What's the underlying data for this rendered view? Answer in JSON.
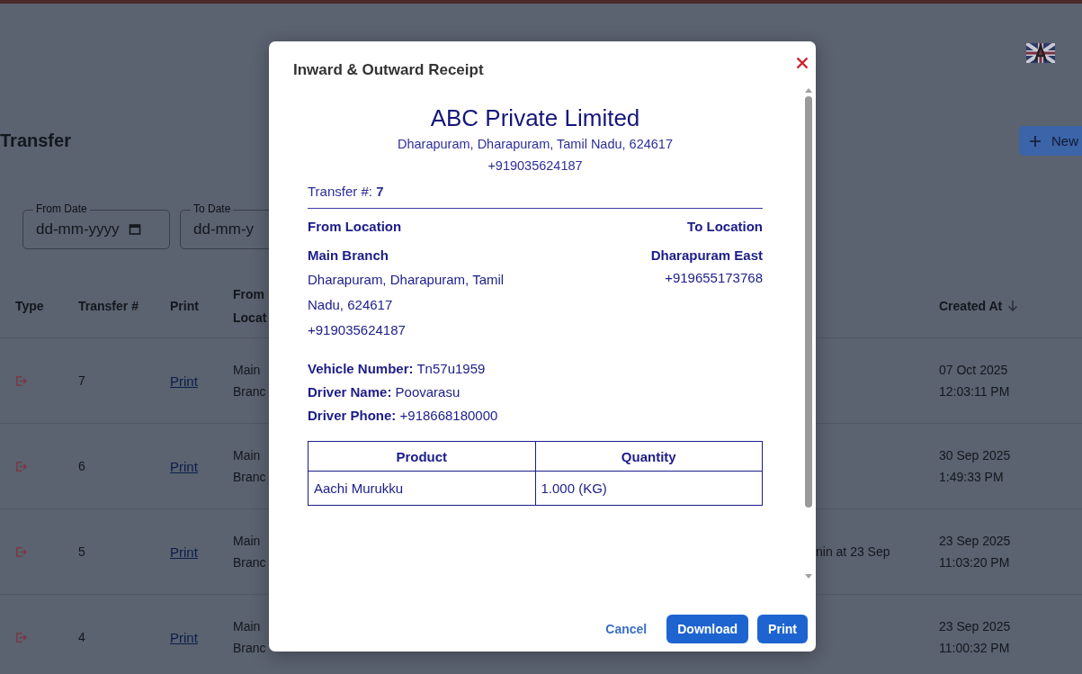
{
  "page": {
    "title": "Transfer",
    "new_button": "New",
    "filters": [
      {
        "label": "From Date",
        "placeholder": "dd-mm-yyyy"
      },
      {
        "label": "To Date",
        "placeholder": "dd-mm-y"
      }
    ]
  },
  "table": {
    "columns": {
      "type": "Type",
      "transfer": "Transfer #",
      "print": "Print",
      "from": "From Locat",
      "created": "Created At"
    },
    "rows": [
      {
        "number": "7",
        "print": "Print",
        "from": "Main Branc",
        "note": "",
        "date": "07 Oct 2025",
        "time": "12:03:11 PM"
      },
      {
        "number": "6",
        "print": "Print",
        "from": "Main Branc",
        "note": "",
        "date": "30 Sep 2025",
        "time": "1:49:33 PM"
      },
      {
        "number": "5",
        "print": "Print",
        "from": "Main Branc",
        "note": "nin at 23 Sep",
        "date": "23 Sep 2025",
        "time": "11:03:20 PM"
      },
      {
        "number": "4",
        "print": "Print",
        "from": "Main Branc",
        "note": "",
        "date": "23 Sep 2025",
        "time": "11:00:32 PM"
      }
    ]
  },
  "dialog": {
    "title": "Inward & Outward Receipt",
    "receipt": {
      "company": "ABC Private Limited",
      "address": "Dharapuram, Dharapuram, Tamil Nadu, 624617",
      "phone": "+919035624187",
      "transfer": "Transfer #: **7**",
      "from_heading": "From Location",
      "to_heading": "To Location",
      "from_name": "Main Branch",
      "from_address": "Dharapuram, Dharapuram, Tamil Nadu, 624617",
      "from_phone": "+919035624187",
      "to_name": "Dharapuram East",
      "to_phone": "+919655173768",
      "details": [
        "**Vehicle Number:** Tn57u1959",
        "**Driver Name:** Poovarasu",
        "**Driver Phone:** +918668180000"
      ],
      "columns": [
        "Product",
        "Quantity"
      ],
      "items": [
        {
          "product": "Aachi Murukku",
          "quantity": "1.000 (KG)"
        }
      ]
    },
    "buttons": [
      {
        "label": "Cancel",
        "kind": "text"
      },
      {
        "label": "Download",
        "kind": "primary"
      },
      {
        "label": "Print",
        "kind": "primary"
      }
    ]
  }
}
